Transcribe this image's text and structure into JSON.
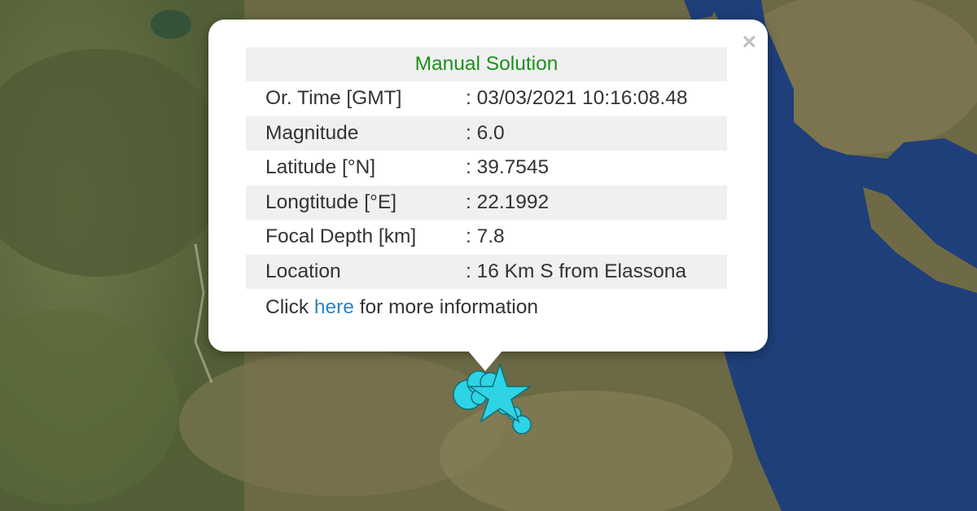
{
  "popup": {
    "title": "Manual Solution",
    "close_label": "×",
    "rows": [
      {
        "label": "Or. Time [GMT]",
        "value": ": 03/03/2021 10:16:08.48"
      },
      {
        "label": "Magnitude",
        "value": ": 6.0"
      },
      {
        "label": "Latitude [°N]",
        "value": ": 39.7545"
      },
      {
        "label": "Longtitude [°E]",
        "value": ": 22.1992"
      },
      {
        "label": "Focal Depth [km]",
        "value": ": 7.8"
      },
      {
        "label": "Location",
        "value": ": 16 Km S from Elassona"
      }
    ],
    "more_prefix": "Click ",
    "more_link": "here",
    "more_suffix": " for more information"
  },
  "markers": {
    "epicenter_icon": "star-icon",
    "aftershock_icon": "circle-icon",
    "color": "#2ed3e6"
  },
  "colors": {
    "title": "#1e8f1e",
    "link": "#2a84c9",
    "sea": "#1f3f7a"
  }
}
